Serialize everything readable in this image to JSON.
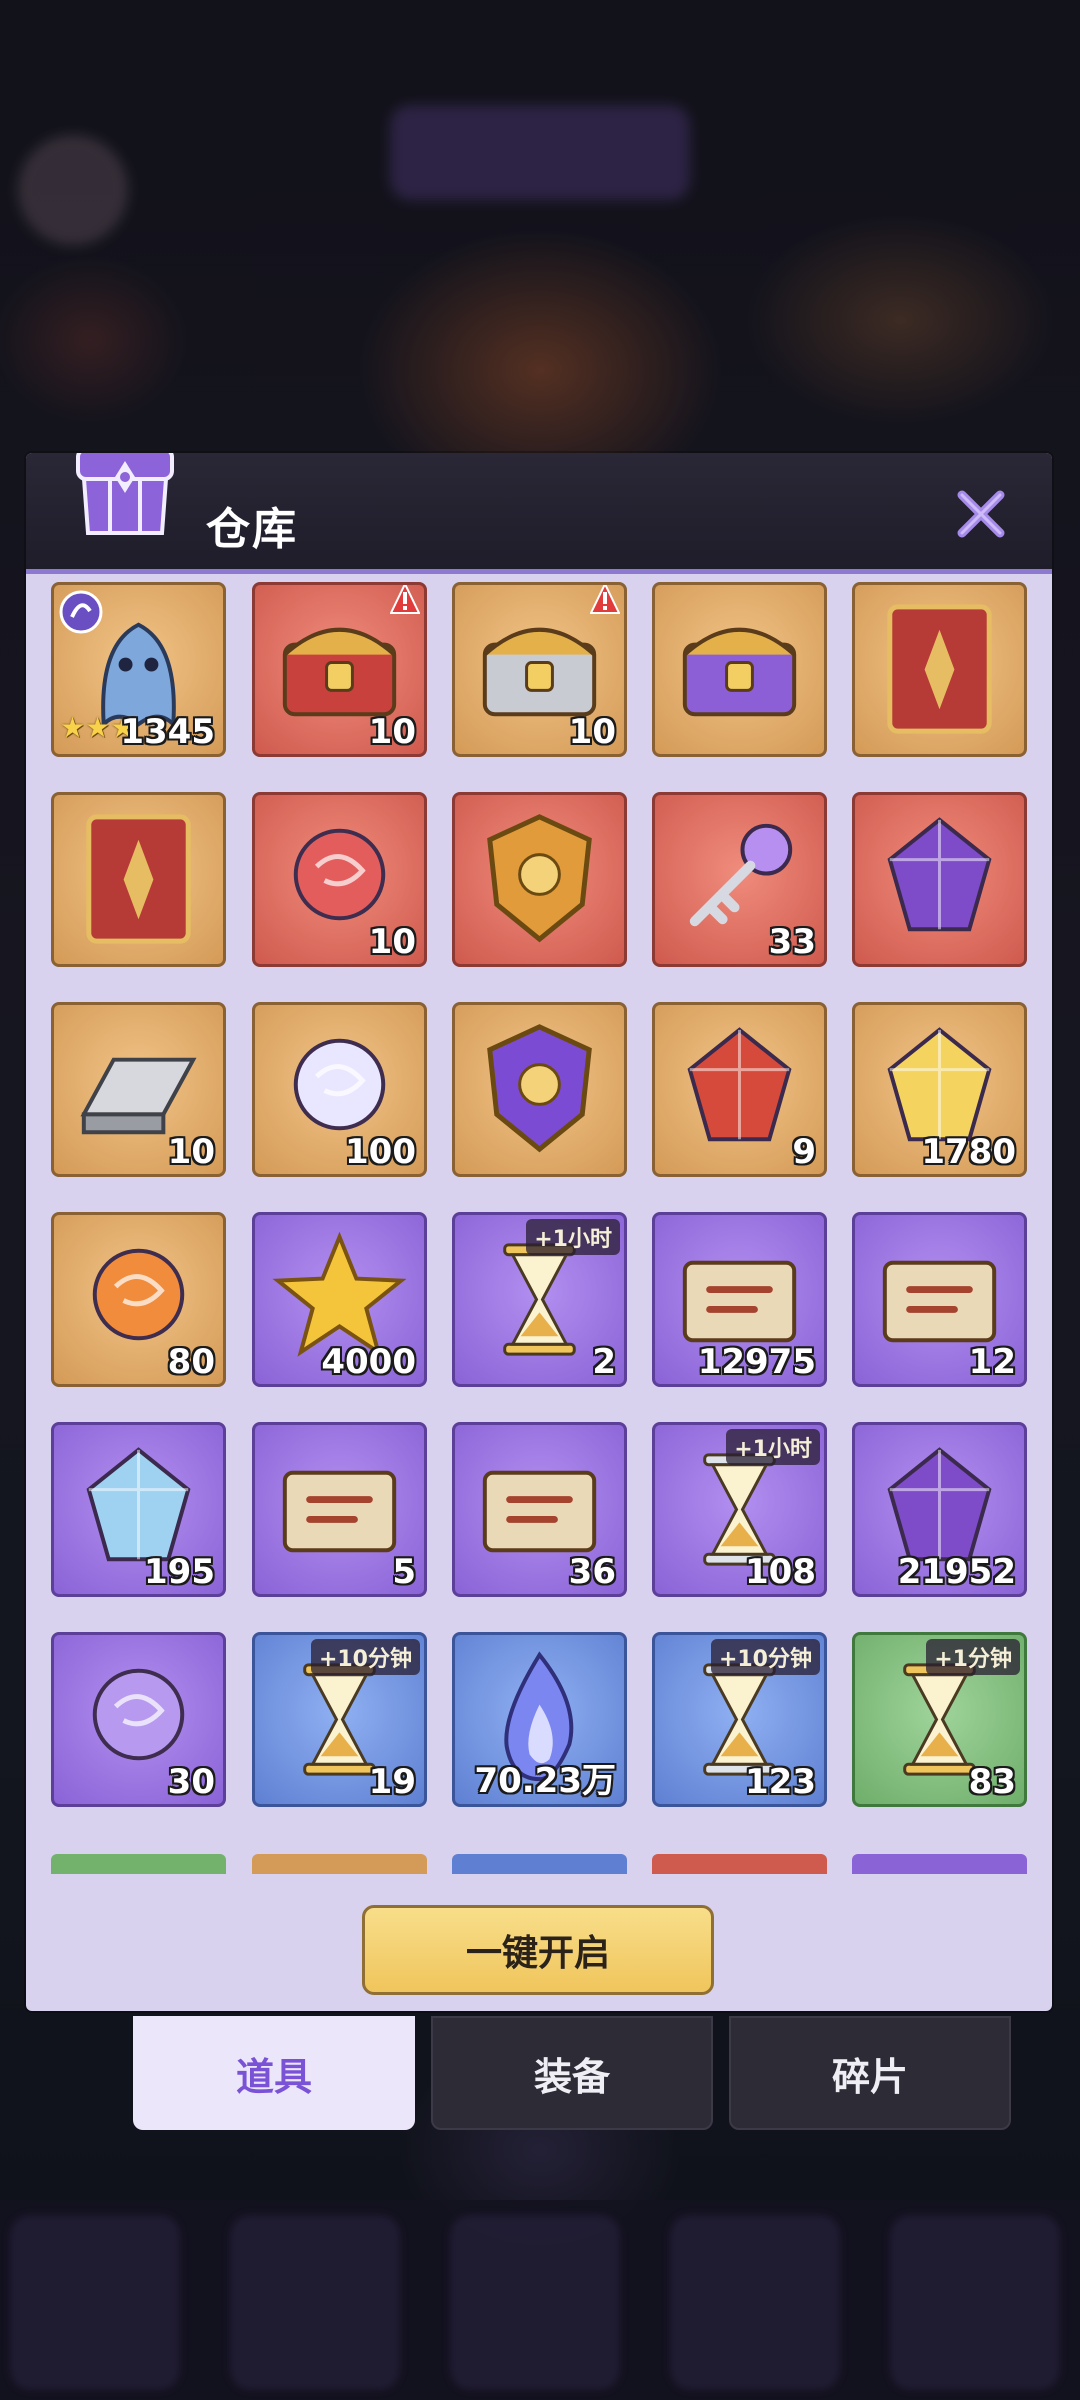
{
  "panel": {
    "title": "仓库",
    "open_all_label": "一键开启"
  },
  "tabs": [
    {
      "label": "道具",
      "active": true
    },
    {
      "label": "装备",
      "active": false
    },
    {
      "label": "碎片",
      "active": false
    }
  ],
  "items": [
    {
      "name": "ghost-pet",
      "qty": "1345",
      "stars": "★★★",
      "color": "orange"
    },
    {
      "name": "red-treasure-chest",
      "qty": "10",
      "color": "red"
    },
    {
      "name": "silver-treasure-chest",
      "qty": "10",
      "color": "orange"
    },
    {
      "name": "purple-crest-chest",
      "qty": "",
      "color": "orange"
    },
    {
      "name": "red-card-pack-timed",
      "qty": "",
      "color": "orange"
    },
    {
      "name": "red-card-pack-timed-2",
      "qty": "",
      "color": "orange"
    },
    {
      "name": "red-swirl-orb",
      "qty": "10",
      "color": "red"
    },
    {
      "name": "gold-shield-emblem",
      "qty": "",
      "color": "red"
    },
    {
      "name": "purple-key",
      "qty": "33",
      "color": "red"
    },
    {
      "name": "galaxy-crystal-frame",
      "qty": "",
      "color": "red"
    },
    {
      "name": "silver-ingot",
      "qty": "10",
      "color": "orange"
    },
    {
      "name": "pearl-orb",
      "qty": "100",
      "color": "orange"
    },
    {
      "name": "purple-eye-medallion",
      "qty": "",
      "color": "orange"
    },
    {
      "name": "red-gem-crown",
      "qty": "9",
      "color": "orange"
    },
    {
      "name": "rainbow-gem",
      "qty": "1780",
      "color": "orange"
    },
    {
      "name": "fire-orb",
      "qty": "80",
      "color": "orange"
    },
    {
      "name": "gold-star",
      "qty": "4000",
      "color": "purple"
    },
    {
      "name": "gold-hourglass-1h",
      "qty": "2",
      "tag": "+1小时",
      "color": "purple"
    },
    {
      "name": "map-scroll",
      "qty": "12975",
      "color": "purple"
    },
    {
      "name": "paper-scroll",
      "qty": "12",
      "color": "purple"
    },
    {
      "name": "ice-crystal",
      "qty": "195",
      "color": "purple"
    },
    {
      "name": "ticket",
      "qty": "5",
      "color": "purple"
    },
    {
      "name": "sword-scroll",
      "qty": "36",
      "color": "purple"
    },
    {
      "name": "silver-hourglass-1h",
      "qty": "108",
      "tag": "+1小时",
      "color": "purple"
    },
    {
      "name": "purple-rune-stone",
      "qty": "21952",
      "color": "purple"
    },
    {
      "name": "purple-swirl-orb",
      "qty": "30",
      "color": "purple"
    },
    {
      "name": "gold-hourglass-10m",
      "qty": "19",
      "tag": "+10分钟",
      "color": "blue"
    },
    {
      "name": "blue-flame",
      "qty": "70.23万",
      "color": "blue"
    },
    {
      "name": "silver-hourglass-10m",
      "qty": "123",
      "tag": "+10分钟",
      "color": "blue"
    },
    {
      "name": "gold-hourglass-1m",
      "qty": "83",
      "tag": "+1分钟",
      "color": "green"
    }
  ],
  "icons": {
    "close": "close-icon",
    "chest": "warehouse-chest-icon",
    "alert": "exclamation-badge-icon",
    "clock": "clock-icon",
    "gem": "gem-icon"
  },
  "colors": {
    "accent_purple": "#7a52d6",
    "header_dark": "#23212f",
    "button_gold": "#f0c55c"
  }
}
